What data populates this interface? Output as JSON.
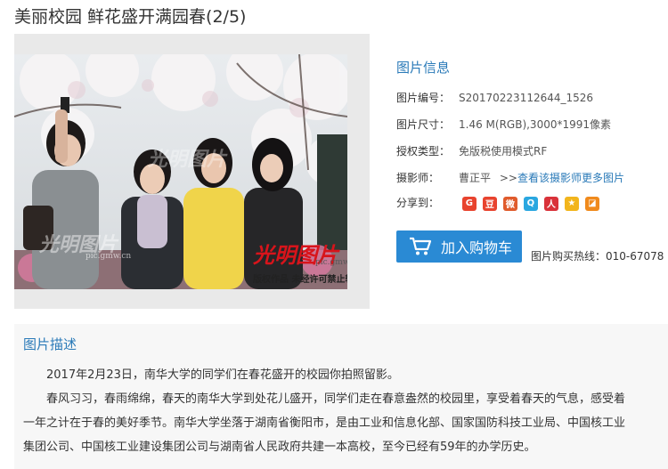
{
  "page": {
    "title": "美丽校园 鲜花盛开满园春(2/5)"
  },
  "photo": {
    "watermark_center": "光明图片",
    "watermark_left": "光明图片",
    "watermark_left_url": "pic.gmw.cn",
    "watermark_right": "光明图片",
    "watermark_right_url": "pic.gmw.cn",
    "copyright": "版权作品  未经许可禁止转载"
  },
  "info": {
    "title": "图片信息",
    "rows": [
      {
        "label": "图片编号：",
        "value": "S20170223112644_1526"
      },
      {
        "label": "图片尺寸：",
        "value": "1.46 M(RGB),3000*1991像素"
      },
      {
        "label": "授权类型：",
        "value": "免版税使用模式RF"
      }
    ],
    "photographer_label": "摄影师：",
    "photographer": "曹正平",
    "more_prefix": ">>",
    "more_link": "查看该摄影师更多图片",
    "share_label": "分享到："
  },
  "share": [
    {
      "name": "google-share-icon",
      "glyph": "G",
      "color": "#e8432e"
    },
    {
      "name": "douban-share-icon",
      "glyph": "豆",
      "color": "#e8432e"
    },
    {
      "name": "weibo-share-icon",
      "glyph": "微",
      "color": "#e05b2c"
    },
    {
      "name": "qq-share-icon",
      "glyph": "Q",
      "color": "#2aa7e0"
    },
    {
      "name": "renren-share-icon",
      "glyph": "人",
      "color": "#d9323a"
    },
    {
      "name": "qzone-share-icon",
      "glyph": "★",
      "color": "#f2b51c"
    },
    {
      "name": "other-share-icon",
      "glyph": "◪",
      "color": "#f08a1c"
    }
  ],
  "cart": {
    "label": "加入购物车"
  },
  "hotline": "图片购买热线：010-67078",
  "description": {
    "title": "图片描述",
    "paragraphs": [
      "2017年2月23日，南华大学的同学们在春花盛开的校园你拍照留影。",
      "春风习习，春雨绵绵，春天的南华大学到处花儿盛开，同学们走在春意盎然的校园里，享受着春天的气息，感受着",
      "一年之计在于春的美好季节。南华大学坐落于湖南省衡阳市，是由工业和信息化部、国家国防科技工业局、中国核工业",
      "集团公司、中国核工业建设集团公司与湖南省人民政府共建一本高校，至今已经有59年的办学历史。"
    ]
  }
}
